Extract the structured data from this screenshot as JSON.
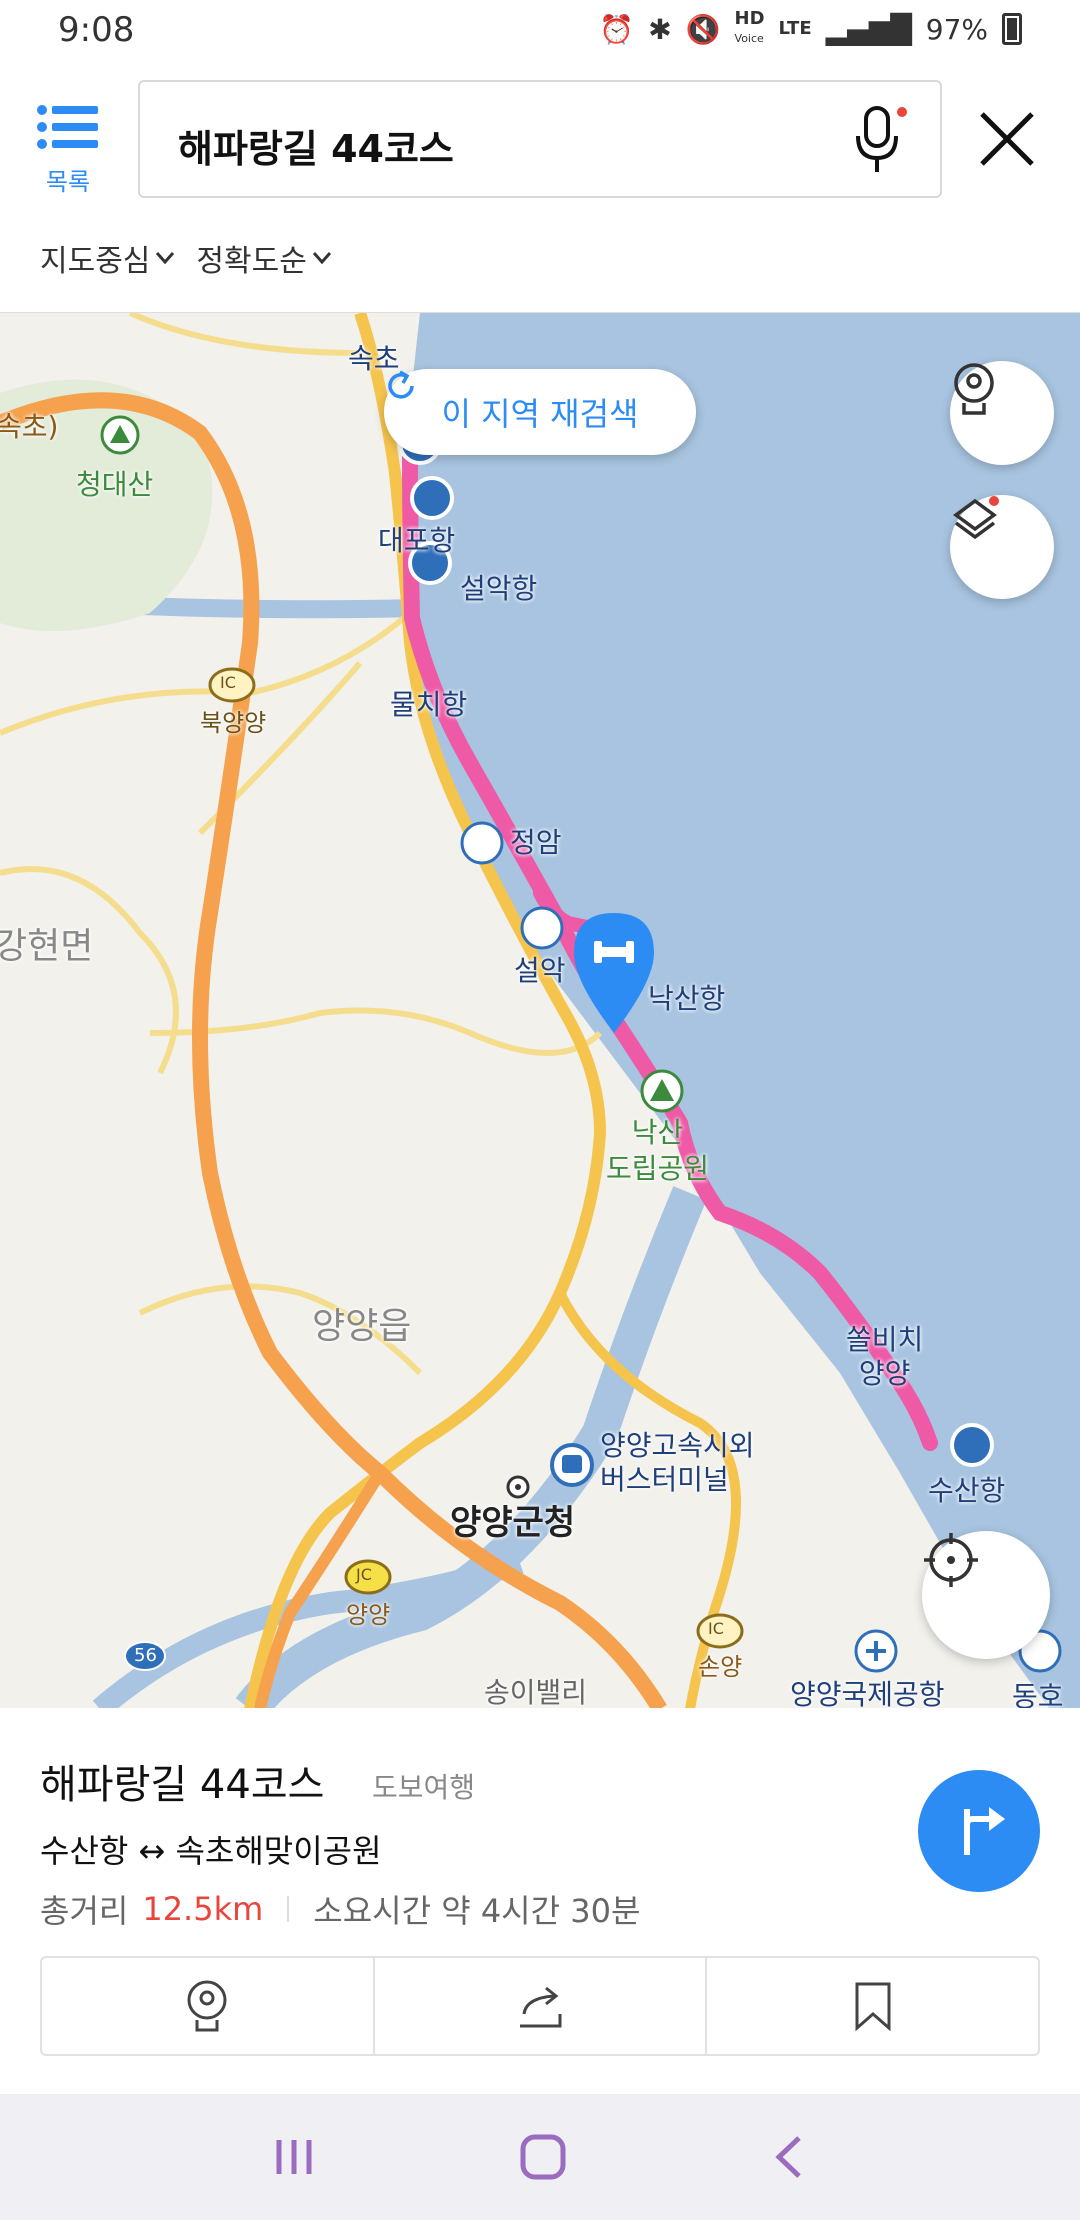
{
  "status": {
    "time": "9:08",
    "hd": "HD",
    "voice": "Voice",
    "lte": "LTE",
    "battery": "97%"
  },
  "header": {
    "list_label": "목록",
    "search_text": "해파랑길 44코스",
    "filters": [
      "지도중심",
      "정확도순"
    ]
  },
  "map": {
    "rescan_label": "이 지역 재검색",
    "labels": {
      "sokcho": "속초",
      "sokcho2": "속초)",
      "cheongdaesan": "청대산",
      "daepo": "대포항",
      "seorak_port": "설악항",
      "mulchi": "물치항",
      "bukyangyang": "북양양",
      "jeongam": "정암",
      "ganghyeon": "강현면",
      "seorak": "설악",
      "naksan_port": "낙산항",
      "naksan_park": "낙산\n도립공원",
      "yangyang_eup": "양양읍",
      "ssolbichi": "쏠비치\n양양",
      "terminal": "양양고속시외\n버스터미널",
      "susan": "수산항",
      "county_office": "양양군청",
      "yangyang_jc": "양양",
      "songi_valley": "송이밸리",
      "sonyang": "손양",
      "airport": "양양국제공항",
      "dongho": "동호",
      "ic": "IC",
      "jc": "JC",
      "route56": "56"
    }
  },
  "course": {
    "title": "해파랑길 44코스",
    "type": "도보여행",
    "route": "수산항 ↔ 속초해맞이공원",
    "distance_label": "총거리",
    "distance": "12.5km",
    "duration": "소요시간 약 4시간 30분"
  },
  "colors": {
    "accent": "#2c8cf4",
    "route": "#ee5aa6",
    "sea": "#a8c4e0",
    "highway": "#f5a14d",
    "distance": "#e8453c"
  }
}
